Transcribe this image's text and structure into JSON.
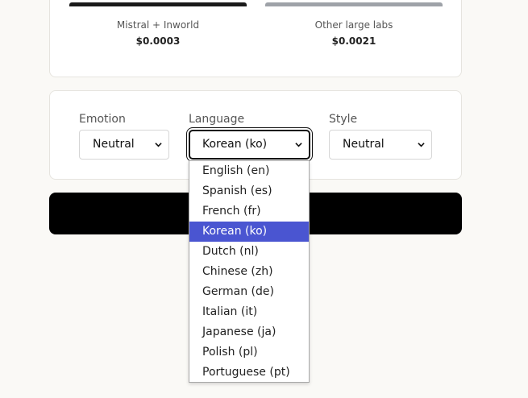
{
  "cost": {
    "left": {
      "name": "Mistral + Inworld",
      "value": "$0.0003",
      "bar_color": "#1a1a1a"
    },
    "right": {
      "name": "Other large labs",
      "value": "$0.0021",
      "bar_color": "#9ea2a8"
    }
  },
  "controls": {
    "emotion": {
      "label": "Emotion",
      "value": "Neutral"
    },
    "language": {
      "label": "Language",
      "value": "Korean (ko)"
    },
    "style": {
      "label": "Style",
      "value": "Neutral"
    }
  },
  "language_options": [
    "English (en)",
    "Spanish (es)",
    "French (fr)",
    "Korean (ko)",
    "Dutch (nl)",
    "Chinese (zh)",
    "German (de)",
    "Italian (it)",
    "Japanese (ja)",
    "Polish (pl)",
    "Portuguese (pt)"
  ],
  "selected_language_index": 3,
  "colors": {
    "selected_option": "#4a55d1",
    "button": "#000000",
    "background": "#faf9f6"
  }
}
